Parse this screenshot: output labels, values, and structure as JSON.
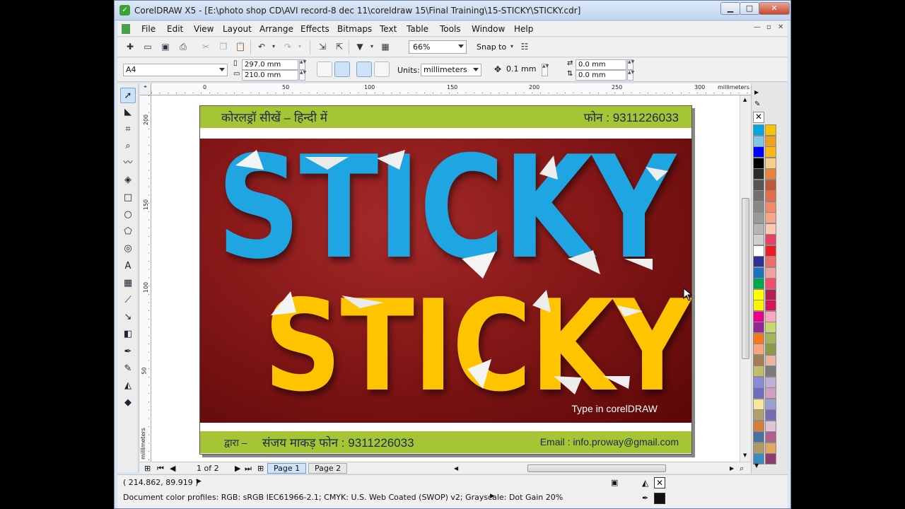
{
  "window": {
    "title": "CorelDRAW X5 - [E:\\photo shop CD\\AVI record-8 dec 11\\coreldraw 15\\Final Training\\15-STICKY\\STICKY.cdr]",
    "min": "▁",
    "max": "□",
    "close": "✕"
  },
  "menu": [
    "File",
    "Edit",
    "View",
    "Layout",
    "Arrange",
    "Effects",
    "Bitmaps",
    "Text",
    "Table",
    "Tools",
    "Window",
    "Help"
  ],
  "doc_controls": {
    "min": "—",
    "restore": "▫",
    "close": "✕"
  },
  "toolbar": {
    "zoom": "66%",
    "snap_to": "Snap to"
  },
  "propbar": {
    "paper": "A4",
    "width": "297.0 mm",
    "height": "210.0 mm",
    "units_label": "Units:",
    "units": "millimeters",
    "nudge": "0.1 mm",
    "dup_x": "0.0 mm",
    "dup_y": "0.0 mm"
  },
  "ruler": {
    "units": "millimeters",
    "h_labels": [
      "0",
      "50",
      "100",
      "150",
      "200",
      "250",
      "300"
    ],
    "v_labels": [
      "200",
      "150",
      "100",
      "50"
    ],
    "v_units": "millimeters"
  },
  "artwork": {
    "top_left": "कोरलड्रॉ सीखें – हिन्दी में",
    "top_right": "फोन : 9311226033",
    "word_blue": "STICKY",
    "word_yellow": "STICKY",
    "caption": "Type in corelDRAW",
    "bottom_left_prefix": "द्वारा –",
    "bottom_left": "संजय माकड़ फोन : 9311226033",
    "bottom_right": "Email : info.proway@gmail.com",
    "colors": {
      "green": "#a6c535",
      "maroon": "#861818",
      "blue": "#1fa6e2",
      "yellow": "#ffc400"
    }
  },
  "pagenav": {
    "counter": "1 of 2",
    "tabs": [
      "Page 1",
      "Page 2"
    ]
  },
  "status": {
    "coords": "( 214.862, 89.919 )",
    "profiles": "Document color profiles: RGB: sRGB IEC61966-2.1; CMYK: U.S. Web Coated (SWOP) v2; Grayscale: Dot Gain 20%"
  },
  "palette": [
    "#00a6e0",
    "#f9c300",
    "#7fc6e8",
    "#f3a020",
    "#0000ff",
    "#fdb813",
    "#000000",
    "#f5d08a",
    "#2b2b2b",
    "#e9823a",
    "#555555",
    "#c0563a",
    "#707070",
    "#e46a50",
    "#888888",
    "#f28a6a",
    "#9a9a9a",
    "#f7a68a",
    "#b5b5b5",
    "#fbc9b0",
    "#cfcfcf",
    "#e84060",
    "#ffffff",
    "#ec1c24",
    "#2e3192",
    "#f06b6b",
    "#1c75bc",
    "#f1a0a0",
    "#00a651",
    "#ef4f73",
    "#ffff00",
    "#b51f4f",
    "#fff200",
    "#d4145a",
    "#ec008c",
    "#f7a8c0",
    "#92278f",
    "#c7d96e",
    "#f47920",
    "#a3b55a",
    "#f6a87c",
    "#8a9a4a",
    "#a67c52",
    "#eab5a0",
    "#c0bd6b",
    "#7c7c7c",
    "#8c8ad6",
    "#c0b0d8",
    "#6d6cc0",
    "#d0a0c0",
    "#f8e6a0",
    "#9aa0d0",
    "#b0a070",
    "#756bb1",
    "#d47f3a",
    "#e0c4d8",
    "#4a6fa5",
    "#b06090",
    "#ae9a64",
    "#e0a860",
    "#3c8bbf",
    "#8c3c70"
  ]
}
